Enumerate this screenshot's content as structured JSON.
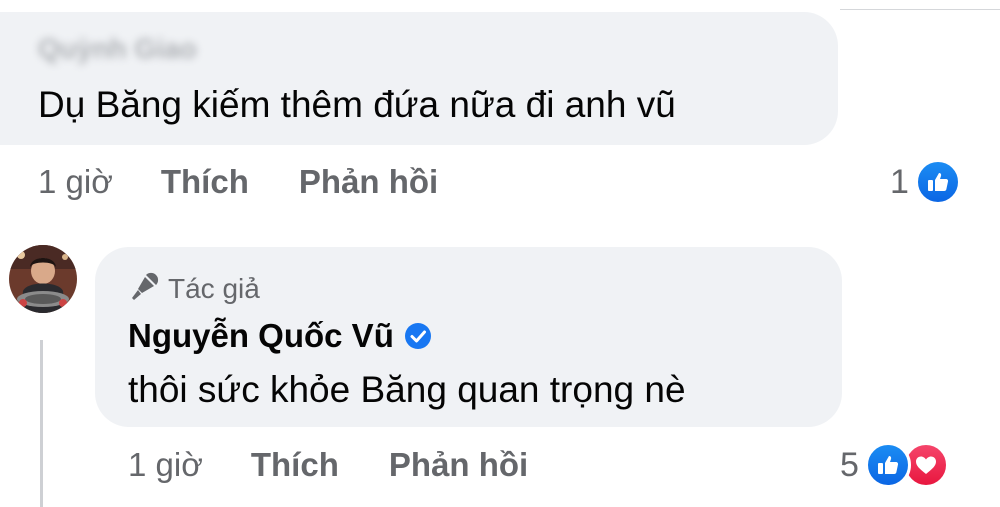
{
  "comment1": {
    "author": "Quỳnh Giao",
    "text": "Dụ Băng kiếm thêm đứa nữa đi anh vũ",
    "time": "1 giờ",
    "like_label": "Thích",
    "reply_label": "Phản hồi",
    "reaction_count": "1",
    "reactions": [
      "like-icon"
    ]
  },
  "comment2": {
    "badge": "Tác giả",
    "author": "Nguyễn Quốc Vũ",
    "verified": true,
    "text": "thôi sức khỏe Băng quan trọng nè",
    "time": "1 giờ",
    "like_label": "Thích",
    "reply_label": "Phản hồi",
    "reaction_count": "5",
    "reactions": [
      "like-icon",
      "heart-icon"
    ]
  },
  "colors": {
    "bubble": "#f0f2f5",
    "secondary_text": "#65676b",
    "like_blue": "#1877f2",
    "love_red": "#f33e58"
  }
}
